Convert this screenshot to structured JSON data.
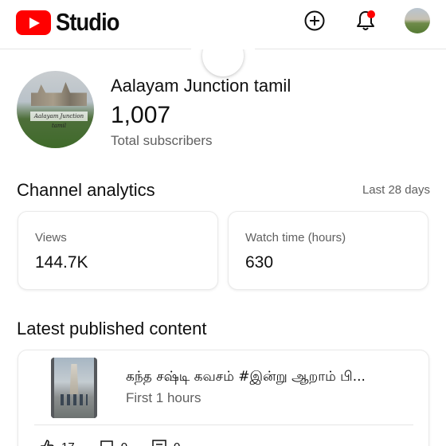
{
  "header": {
    "logo_text": "Studio",
    "brand_color": "#ff0000",
    "icons": [
      "create-icon",
      "bell-icon",
      "account-avatar"
    ]
  },
  "channel": {
    "name": "Aalayam Junction tamil",
    "avatar_watermark": "Aalayam Junction tamil",
    "subscriber_count": "1,007",
    "subscriber_label": "Total subscribers"
  },
  "analytics": {
    "title": "Channel analytics",
    "period": "Last 28 days",
    "cards": [
      {
        "label": "Views",
        "value": "144.7K"
      },
      {
        "label": "Watch time (hours)",
        "value": "630"
      }
    ]
  },
  "latest": {
    "title": "Latest published content",
    "video": {
      "title": "கந்த சஷ்டி கவசம் #இன்று ஆறாம் பி...",
      "time": "First 1 hours",
      "stats": [
        {
          "icon": "like-icon",
          "value": "17"
        },
        {
          "icon": "comment-icon",
          "value": "0"
        },
        {
          "icon": "views-icon",
          "value": "0"
        }
      ]
    }
  }
}
